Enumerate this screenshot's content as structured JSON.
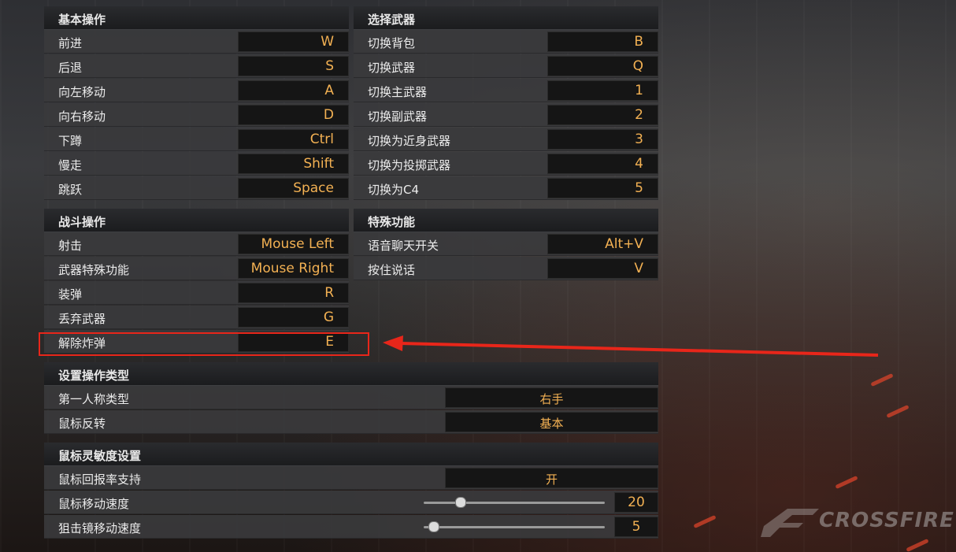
{
  "basic_ops": {
    "title": "基本操作",
    "rows": [
      {
        "label": "前进",
        "key": "W"
      },
      {
        "label": "后退",
        "key": "S"
      },
      {
        "label": "向左移动",
        "key": "A"
      },
      {
        "label": "向右移动",
        "key": "D"
      },
      {
        "label": "下蹲",
        "key": "Ctrl"
      },
      {
        "label": "慢走",
        "key": "Shift"
      },
      {
        "label": "跳跃",
        "key": "Space"
      }
    ]
  },
  "weapon_select": {
    "title": "选择武器",
    "rows": [
      {
        "label": "切换背包",
        "key": "B"
      },
      {
        "label": "切换武器",
        "key": "Q"
      },
      {
        "label": "切换主武器",
        "key": "1"
      },
      {
        "label": "切换副武器",
        "key": "2"
      },
      {
        "label": "切换为近身武器",
        "key": "3"
      },
      {
        "label": "切换为投掷武器",
        "key": "4"
      },
      {
        "label": "切换为C4",
        "key": "5"
      }
    ]
  },
  "combat_ops": {
    "title": "战斗操作",
    "rows": [
      {
        "label": "射击",
        "key": "Mouse Left"
      },
      {
        "label": "武器特殊功能",
        "key": "Mouse Right"
      },
      {
        "label": "装弹",
        "key": "R"
      },
      {
        "label": "丢弃武器",
        "key": "G"
      },
      {
        "label": "解除炸弹",
        "key": "E"
      }
    ]
  },
  "special": {
    "title": "特殊功能",
    "rows": [
      {
        "label": "语音聊天开关",
        "key": "Alt+V"
      },
      {
        "label": "按住说话",
        "key": "V"
      }
    ]
  },
  "op_type": {
    "title": "设置操作类型",
    "rows": [
      {
        "label": "第一人称类型",
        "value": "右手"
      },
      {
        "label": "鼠标反转",
        "value": "基本"
      }
    ]
  },
  "mouse_sens": {
    "title": "鼠标灵敏度设置",
    "report_rate": {
      "label": "鼠标回报率支持",
      "value": "开"
    },
    "move_speed": {
      "label": "鼠标移动速度",
      "value": "20",
      "fraction": 0.2
    },
    "scope_speed": {
      "label": "狙击镜移动速度",
      "value": "5",
      "fraction": 0.05
    }
  },
  "logo": {
    "text": "CROSSFIRE",
    "mark": "CF"
  },
  "colors": {
    "key_text": "#f3b153",
    "highlight": "#e8261a"
  }
}
